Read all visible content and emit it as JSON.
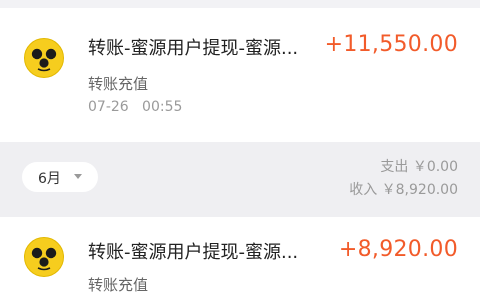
{
  "records": [
    {
      "title": "转账-蜜源用户提现-蜜源...",
      "amount": "+11,550.00",
      "subtitle": "转账充值",
      "datetime": "07-26   00:55",
      "avatar_icon": "yellow-face-icon"
    },
    {
      "title": "转账-蜜源用户提现-蜜源...",
      "amount": "+8,920.00",
      "subtitle": "转账充值",
      "avatar_icon": "yellow-face-icon"
    }
  ],
  "month_section": {
    "month": "6月",
    "expense": "支出 ￥0.00",
    "income": "收入 ￥8,920.00"
  },
  "colors": {
    "amount": "#f25b2a",
    "avatar": "#f6cd1e",
    "background": "#efeff2"
  }
}
